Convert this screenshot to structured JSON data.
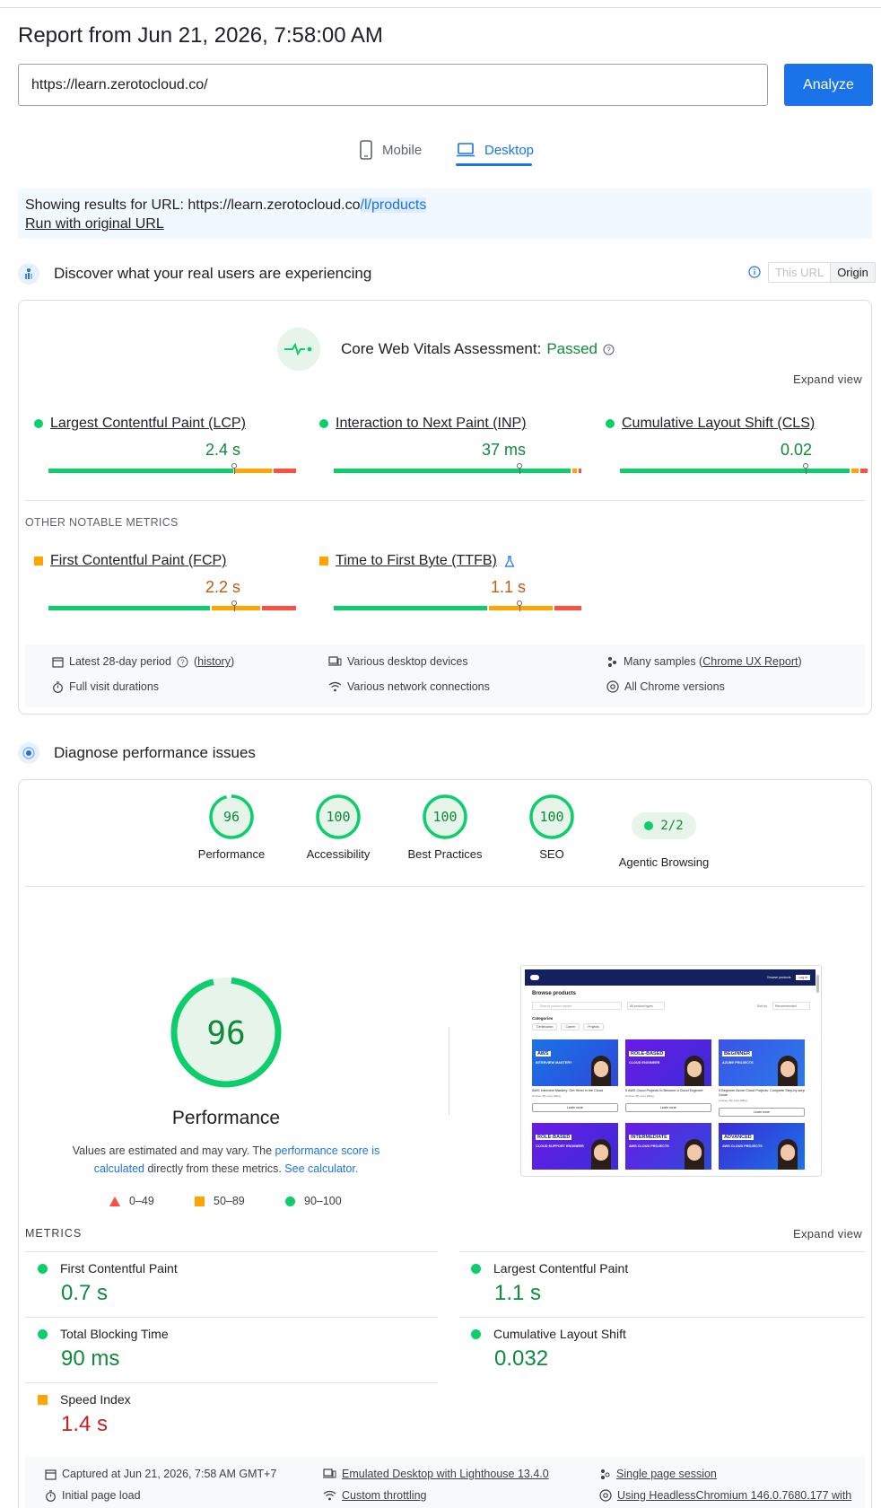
{
  "report": {
    "title": "Report from Jun 21, 2026, 7:58:00 AM"
  },
  "search": {
    "url_value": "https://learn.zerotocloud.co/",
    "analyze_label": "Analyze"
  },
  "device_tabs": {
    "mobile": "Mobile",
    "desktop": "Desktop",
    "active": "desktop"
  },
  "notice": {
    "prefix": "Showing results for URL: https://learn.zerotocloud.co",
    "highlight": "/l/products",
    "run_original": "Run with original URL"
  },
  "field": {
    "heading": "Discover what your real users are experiencing",
    "toggle": {
      "this_url": "This URL",
      "origin": "Origin"
    },
    "cwv_label": "Core Web Vitals Assessment:",
    "cwv_status": "Passed",
    "expand_view": "Expand view",
    "metrics": [
      {
        "name": "Largest Contentful Paint (LCP)",
        "value": "2.4 s",
        "rating": "good",
        "segments": [
          75,
          15,
          9
        ],
        "marker": 0.75
      },
      {
        "name": "Interaction to Next Paint (INP)",
        "value": "37 ms",
        "rating": "good",
        "segments": [
          97,
          2,
          1
        ],
        "marker": 0.75
      },
      {
        "name": "Cumulative Layout Shift (CLS)",
        "value": "0.02",
        "rating": "good",
        "segments": [
          94,
          3,
          3
        ],
        "marker": 0.75
      }
    ],
    "other_heading": "OTHER NOTABLE METRICS",
    "other_metrics": [
      {
        "name": "First Contentful Paint (FCP)",
        "value": "2.2 s",
        "rating": "average",
        "segments": [
          66,
          20,
          14
        ],
        "marker": 0.75
      },
      {
        "name": "Time to First Byte (TTFB)",
        "value": "1.1 s",
        "rating": "average",
        "segments": [
          63,
          26,
          11
        ],
        "marker": 0.75
      }
    ],
    "footer": {
      "period": "Latest 28-day period",
      "history": "history",
      "devices": "Various desktop devices",
      "samples_prefix": "Many samples (",
      "samples_link": "Chrome UX Report",
      "samples_suffix": ")",
      "durations": "Full visit durations",
      "network": "Various network connections",
      "chrome": "All Chrome versions"
    }
  },
  "lab": {
    "heading": "Diagnose performance issues",
    "scores": [
      {
        "label": "Performance",
        "value": "96"
      },
      {
        "label": "Accessibility",
        "value": "100"
      },
      {
        "label": "Best Practices",
        "value": "100"
      },
      {
        "label": "SEO",
        "value": "100"
      }
    ],
    "agentic": {
      "label": "Agentic Browsing",
      "value": "2/2"
    },
    "big_score": {
      "value": "96",
      "label": "Performance",
      "fraction": 0.96
    },
    "desc_1": "Values are estimated and may vary. The ",
    "desc_link_1": "performance score is calculated",
    "desc_2": " directly from these metrics. ",
    "desc_link_2": "See calculator.",
    "legend": {
      "fail": "0–49",
      "average": "50–89",
      "pass": "90–100"
    },
    "metrics_heading": "METRICS",
    "expand_view": "Expand view",
    "metrics": [
      {
        "name": "First Contentful Paint",
        "value": "0.7 s",
        "rating": "good"
      },
      {
        "name": "Largest Contentful Paint",
        "value": "1.1 s",
        "rating": "good"
      },
      {
        "name": "Total Blocking Time",
        "value": "90 ms",
        "rating": "good"
      },
      {
        "name": "Cumulative Layout Shift",
        "value": "0.032",
        "rating": "good"
      },
      {
        "name": "Speed Index",
        "value": "1.4 s",
        "rating": "average"
      }
    ],
    "footer": {
      "captured": "Captured at Jun 21, 2026, 7:58 AM GMT+7",
      "emulated": "Emulated Desktop with Lighthouse 13.4.0",
      "session": "Single page session",
      "initial": "Initial page load",
      "throttling": "Custom throttling",
      "using": "Using HeadlessChromium 146.0.7680.177 with"
    },
    "thumbnail": {
      "browse": "Browse products",
      "search_placeholder": "Search product names",
      "all_types": "All product types",
      "sort_by": "Sort by",
      "recommended": "Recommended",
      "categories": "Categories",
      "chips": [
        "Certification",
        "Career",
        "Projects"
      ],
      "nav_link": "Browse products",
      "nav_login": "Log in",
      "cards": [
        {
          "badge": "AWS",
          "line": "INTERVIEW MASTERY",
          "title": "AWS Interview Mastery: Get Hired in the Cloud",
          "meta": "Course • By Lucy Wang",
          "btn": "Learn more"
        },
        {
          "badge": "ROLE-BASED",
          "line": "CLOUD ENGINEER",
          "title": "5 AWS Cloud Projects to Become a Cloud Engineer",
          "meta": "Course • By Lucy Wang",
          "btn": "Learn more"
        },
        {
          "badge": "BEGINNER",
          "line": "AZURE PROJECTS",
          "title": "5 Beginner Azure Cloud Projects: Complete Step-by-step Guide",
          "meta": "Course • By Lucy Wang",
          "btn": "Learn more"
        },
        {
          "badge": "ROLE-BASED",
          "line": "CLOUD SUPPORT ENGINEER",
          "title": "",
          "meta": "",
          "btn": ""
        },
        {
          "badge": "INTERMEDIATE",
          "line": "AWS CLOUD PROJECTS",
          "title": "",
          "meta": "",
          "btn": ""
        },
        {
          "badge": "ADVANCED",
          "line": "AWS CLOUD PROJECTS",
          "title": "",
          "meta": "",
          "btn": ""
        }
      ]
    }
  },
  "colors": {
    "good": "#0cce6b",
    "average": "#ffa400",
    "poor": "#ff4e42",
    "accent": "#1a73e8"
  }
}
